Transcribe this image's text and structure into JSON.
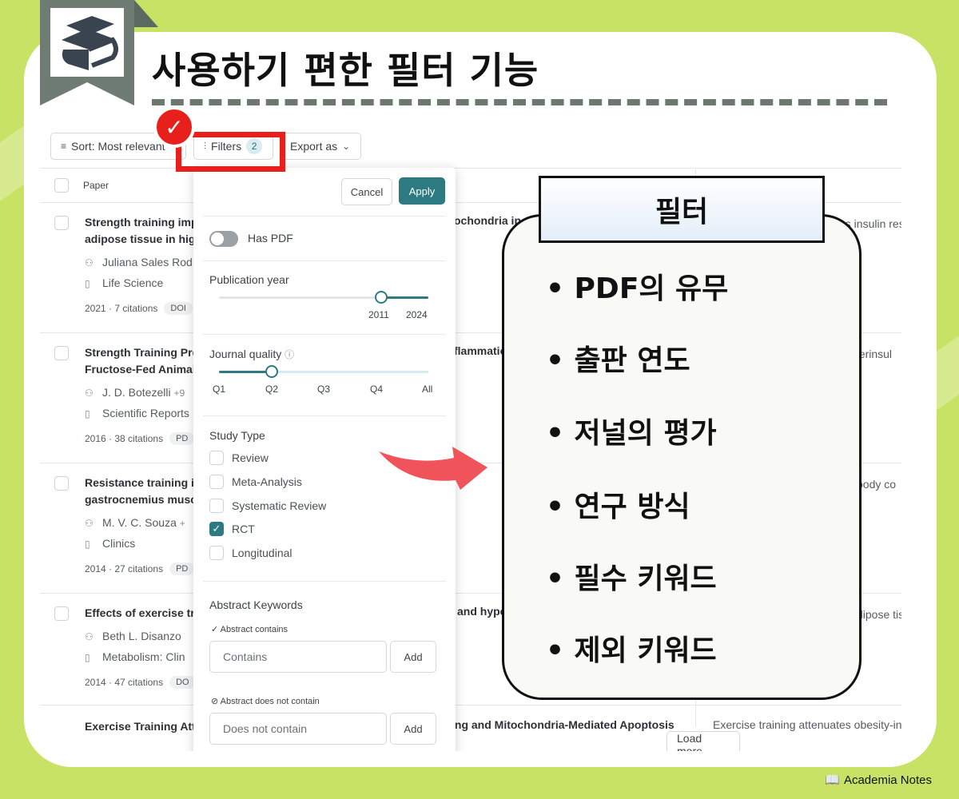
{
  "headline": "사용하기 편한 필터 기능",
  "toolbar": {
    "sort_label": "Sort: Most relevant",
    "filters_label": "Filters",
    "filters_count": "2",
    "export_label": "Export as"
  },
  "table": {
    "col_paper": "Paper"
  },
  "rows": [
    {
      "title": "Strength training improves ... mitochondria in ... adipose tissue in high",
      "title_l1": "Strength training imp",
      "title_l2": "adipose tissue in hig",
      "title_mid": "ochondria in",
      "author": "Juliana Sales Rod",
      "journal": "Life Science",
      "meta": "2021 · 7 citations",
      "tag": "DOI",
      "right": "es insulin res"
    },
    {
      "title_l1": "Strength Training Pre",
      "title_l2": "Fructose-Fed Animal",
      "title_mid": "flammatio",
      "author": "J. D. Botezelli",
      "author_more": "+9",
      "journal": "Scientific Reports",
      "meta": "2016 · 38 citations",
      "tag": "PD",
      "right": "yperinsul"
    },
    {
      "title_l1": "Resistance training in",
      "title_l2": "gastrocnemius muscl",
      "title_mid": "",
      "author": "M. V. C. Souza",
      "author_more": "+",
      "journal": "Clinics",
      "meta": "2014 · 27 citations",
      "tag": "PD",
      "right": "body co"
    },
    {
      "title_l1": "Effects of exercise tra",
      "title_l2": "",
      "title_mid": "and hype",
      "author": "Beth L. Disanzo",
      "journal": "Metabolism: Clin",
      "meta": "2014 · 47 citations",
      "tag": "DO",
      "right": "dipose tis"
    },
    {
      "title_l1": "Exercise Training Atte",
      "title_mid": "ing and Mitochondria-Mediated Apoptosis",
      "right": "Exercise training attenuates obesity-in"
    }
  ],
  "load_more": "Load more",
  "panel": {
    "cancel": "Cancel",
    "apply": "Apply",
    "has_pdf": "Has PDF",
    "pub_year": "Publication year",
    "year_from": "2011",
    "year_to": "2024",
    "year_from_frac": 0.77,
    "journal_quality": "Journal quality",
    "quality_ticks": [
      "Q1",
      "Q2",
      "Q3",
      "Q4",
      "All"
    ],
    "quality_selected": "Q2",
    "study_type": "Study Type",
    "study_options": [
      {
        "label": "Review",
        "checked": false
      },
      {
        "label": "Meta-Analysis",
        "checked": false
      },
      {
        "label": "Systematic Review",
        "checked": false
      },
      {
        "label": "RCT",
        "checked": true
      },
      {
        "label": "Longitudinal",
        "checked": false
      }
    ],
    "abstract_keywords": "Abstract Keywords",
    "abstract_contains": "Abstract contains",
    "contains_placeholder": "Contains",
    "abstract_not_contains": "Abstract does not contain",
    "not_contains_placeholder": "Does not contain",
    "add": "Add"
  },
  "callout": {
    "title": "필터",
    "items": [
      "PDF의 유무",
      "출판 연도",
      "저널의 평가",
      "연구 방식",
      "필수 키워드",
      "제외 키워드"
    ]
  },
  "brand": "Academia Notes",
  "colors": {
    "background": "#c8e266",
    "accent": "#2d7a82",
    "highlight": "#e8201b",
    "arrow": "#f0545a"
  }
}
